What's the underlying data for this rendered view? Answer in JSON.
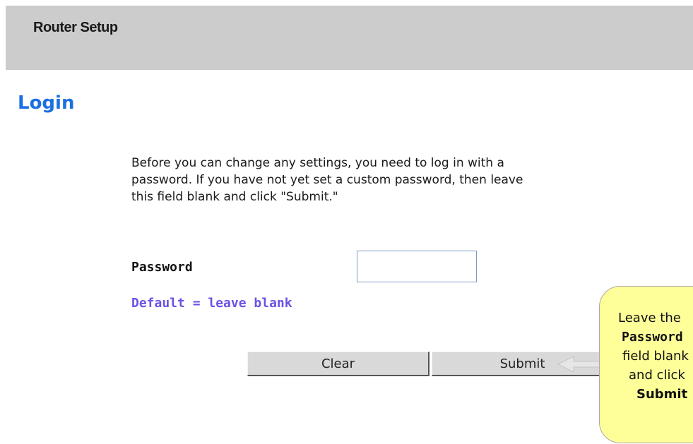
{
  "header": {
    "title": "Router Setup"
  },
  "page": {
    "title": "Login"
  },
  "intro": {
    "lines": [
      "Before you can change any settings, you need to log in with a",
      "password. If you have not yet set a custom password, then leave",
      "this field blank and click \"Submit.\""
    ]
  },
  "form": {
    "password_label": "Password",
    "password_value": "",
    "password_hint": "Default = leave blank",
    "clear_label": "Clear",
    "submit_label": "Submit"
  },
  "callout": {
    "lines": [
      "Leave the",
      "Password",
      "field blank",
      "and click",
      "Submit"
    ]
  },
  "colors": {
    "header_bg": "#cccccc",
    "title": "#1b6fe3",
    "hint": "#6a52e8",
    "callout_bg": "#ffff99"
  }
}
